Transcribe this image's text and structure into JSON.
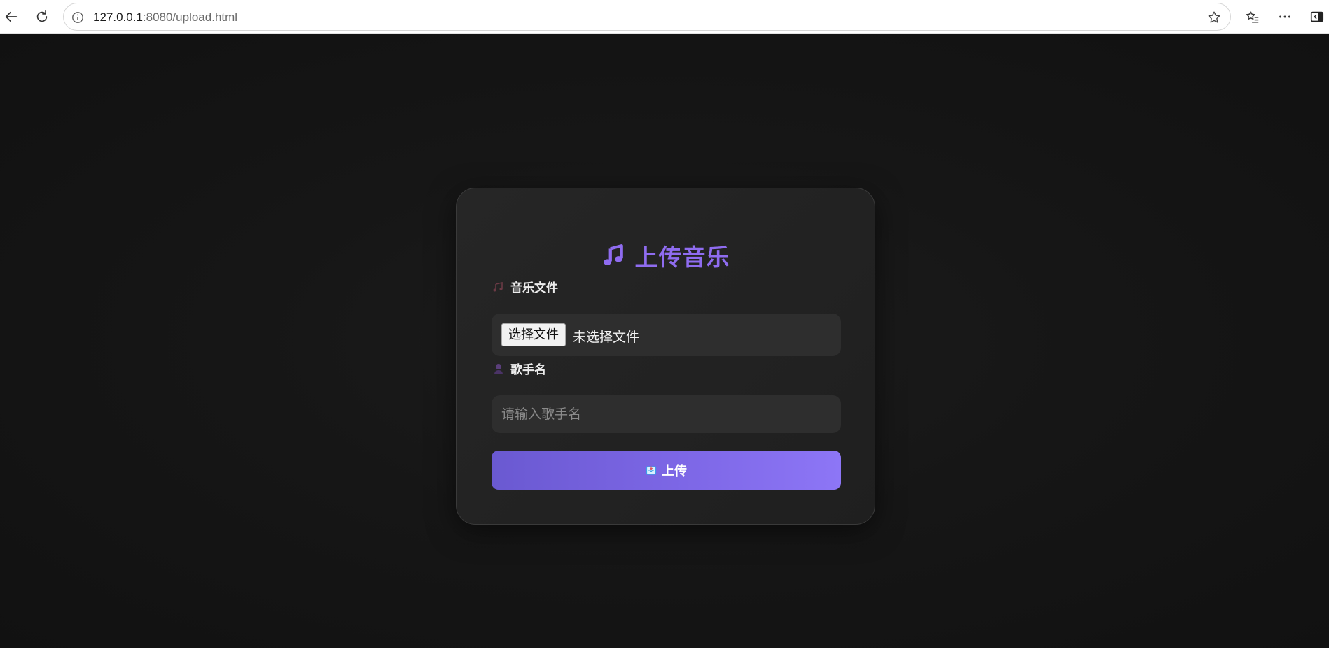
{
  "browser": {
    "url_host": "127.0.0.1",
    "url_rest": ":8080/upload.html"
  },
  "form": {
    "title": "上传音乐",
    "file_label": "音乐文件",
    "file_button": "选择文件",
    "file_status": "未选择文件",
    "singer_label": "歌手名",
    "singer_placeholder": "请输入歌手名",
    "singer_value": "",
    "submit_label": "上传"
  },
  "theme": {
    "accent": "#8f6cf0",
    "button_gradient_start": "#6a59d1",
    "button_gradient_end": "#8d76f6",
    "card_bg": "#232323",
    "page_bg": "#121212"
  }
}
